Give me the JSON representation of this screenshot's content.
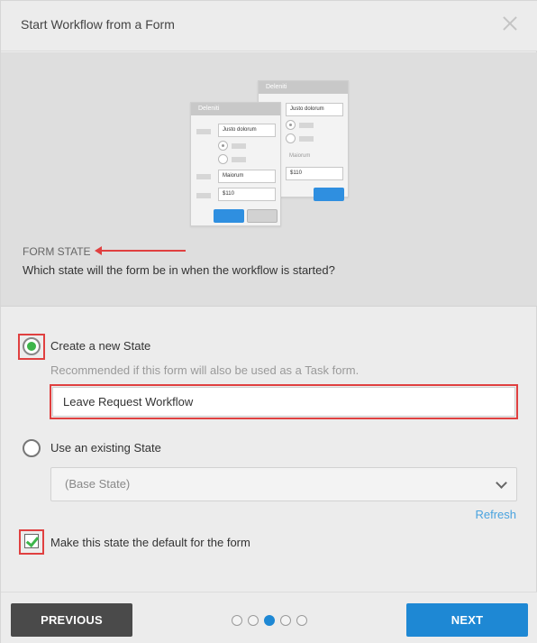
{
  "dialog": {
    "title": "Start Workflow from a Form"
  },
  "banner": {
    "illustration": {
      "back_card": {
        "title": "Deleniti",
        "field1": "Justo dolorum",
        "field_label": "Maiorum",
        "field2": "$110"
      },
      "front_card": {
        "title": "Deleniti",
        "field1": "Justo dolorum",
        "field2": "Maiorum",
        "field3": "$110"
      }
    },
    "section_label": "FORM STATE",
    "question": "Which state will the form be in when the workflow is started?"
  },
  "options": {
    "new_state": {
      "label": "Create a new State",
      "hint": "Recommended if this form will also be used as a Task form.",
      "input_value": "Leave Request Workflow",
      "selected": true
    },
    "existing_state": {
      "label": "Use an existing State",
      "select_value": "(Base State)",
      "selected": false
    },
    "refresh_label": "Refresh",
    "default_checkbox": {
      "label": "Make this state the default for the form",
      "checked": true
    }
  },
  "footer": {
    "previous_label": "PREVIOUS",
    "next_label": "NEXT",
    "steps_total": 5,
    "current_step": 3
  },
  "colors": {
    "accent": "#1e88d4",
    "highlight": "#e04040",
    "radio_selected": "#3db54a",
    "link": "#4aa3df"
  }
}
